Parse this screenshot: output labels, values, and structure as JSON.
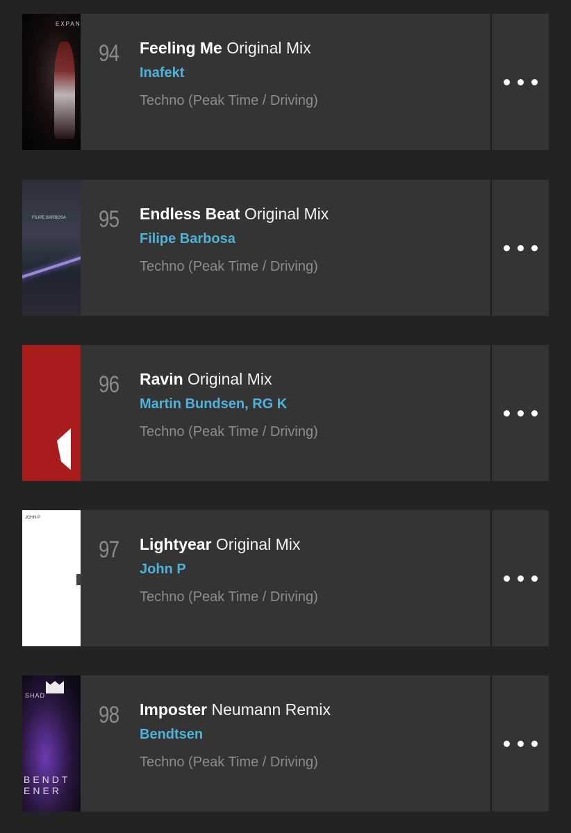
{
  "tracks": [
    {
      "rank": "94",
      "title": "Feeling Me",
      "mix": "Original Mix",
      "artist": "Inafekt",
      "genre": "Techno (Peak Time / Driving)",
      "art_text": "EXPANS"
    },
    {
      "rank": "95",
      "title": "Endless Beat",
      "mix": "Original Mix",
      "artist": "Filipe Barbosa",
      "genre": "Techno (Peak Time / Driving)",
      "art_text": "FILIPE BARBOSA"
    },
    {
      "rank": "96",
      "title": "Ravin",
      "mix": "Original Mix",
      "artist": "Martin Bundsen, RG K",
      "genre": "Techno (Peak Time / Driving)",
      "art_text": ""
    },
    {
      "rank": "97",
      "title": "Lightyear",
      "mix": "Original Mix",
      "artist": "John P",
      "genre": "Techno (Peak Time / Driving)",
      "art_text": "JOHN P"
    },
    {
      "rank": "98",
      "title": "Imposter",
      "mix": "Neumann Remix",
      "artist": "Bendtsen",
      "genre": "Techno (Peak Time / Driving)",
      "art_text": "BENDT ENER",
      "art_text_small": "SHAD"
    }
  ],
  "colors": {
    "background": "#232323",
    "row": "#343434",
    "artist_link": "#4fb3d9",
    "genre": "#8d8d8d",
    "rank": "#8a8a8a"
  },
  "icons": {
    "menu": "more-dots-icon"
  }
}
